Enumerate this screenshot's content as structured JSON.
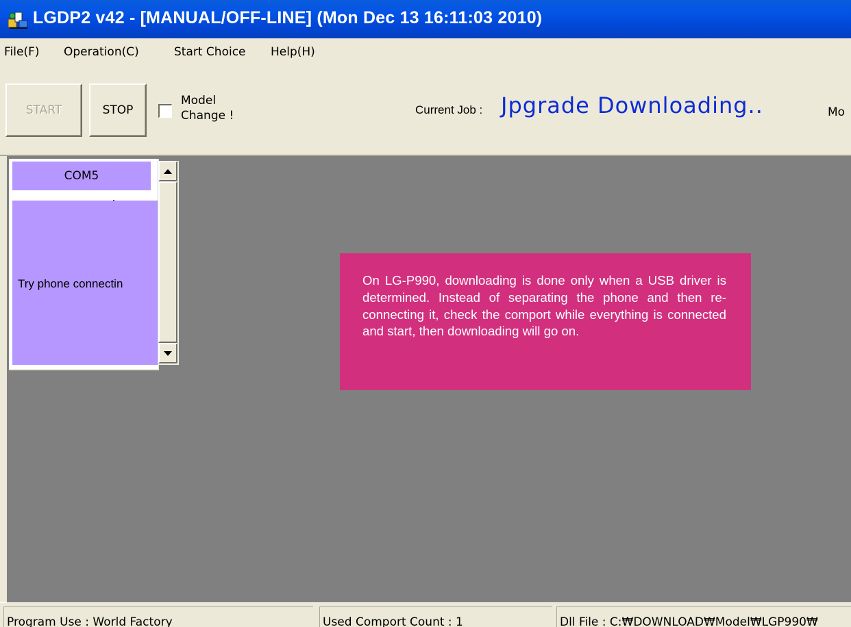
{
  "window": {
    "title": "LGDP2 v42 - [MANUAL/OFF-LINE] (Mon Dec 13 16:11:03 2010)",
    "title_bar_color": "#0455e6"
  },
  "menu": {
    "items": [
      {
        "label": "File(F)"
      },
      {
        "label": "Operation(C)"
      },
      {
        "label": "Start Choice"
      },
      {
        "label": "Help(H)"
      }
    ]
  },
  "toolbar": {
    "start_label": "START",
    "stop_label": "STOP",
    "model_change_line1": "Model",
    "model_change_line2": "Change !",
    "model_change_checked": false,
    "current_job_label": "Current Job :",
    "current_job_value": "Jpgrade Downloading..",
    "current_job_color": "#0d2bd6",
    "mode_clipped": "Mo"
  },
  "com_panel": {
    "port": "COM5",
    "status_message": "Try phone connectin",
    "panel_color": "#b597ff"
  },
  "note": {
    "text": "On LG-P990, downloading is done only when a USB driver is determined. Instead of separating the phone and then re-connecting it, check the comport while everything is connected and start, then downloading will go on.",
    "background": "#d2307f"
  },
  "statusbar": {
    "program_use": "Program Use : World Factory",
    "comport_count": "Used Comport Count : 1",
    "dll_file": "Dll File : C:₩DOWNLOAD₩Model₩LGP990₩"
  }
}
